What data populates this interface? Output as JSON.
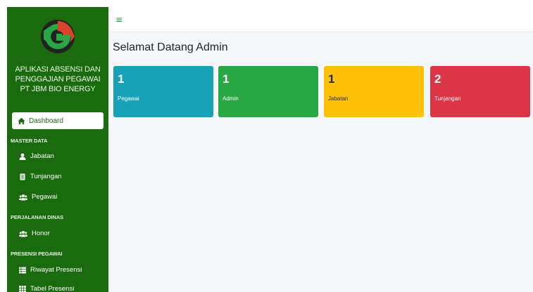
{
  "sidebar": {
    "brand_lines": [
      "APLIKASI ABSENSI DAN",
      "PENGGAJIAN PEGAWAI",
      "PT JBM BIO ENERGY"
    ],
    "active_item": {
      "label": "Dashboard",
      "icon": "home-icon"
    },
    "sections": [
      {
        "title": "MASTER DATA",
        "items": [
          {
            "label": "Jabatan",
            "icon": "user-icon"
          },
          {
            "label": "Tunjangan",
            "icon": "document-icon"
          },
          {
            "label": "Pegawai",
            "icon": "users-icon"
          }
        ]
      },
      {
        "title": "PERJALANAN DINAS",
        "items": [
          {
            "label": "Honor",
            "icon": "users-icon"
          }
        ]
      },
      {
        "title": "PRESENSI PEGAWAI",
        "items": [
          {
            "label": "Riwayat Presensi",
            "icon": "table-icon"
          },
          {
            "label": "Tabel Presensi",
            "icon": "grid-icon"
          }
        ]
      }
    ]
  },
  "topbar": {
    "menu_icon": "hamburger-icon",
    "menu_glyph": "≡"
  },
  "main": {
    "title": "Selamat Datang Admin",
    "cards": [
      {
        "value": "1",
        "label": "Pegawai",
        "color": "#17a2b8"
      },
      {
        "value": "1",
        "label": "Admin",
        "color": "#28a745"
      },
      {
        "value": "1",
        "label": "Jabatan",
        "color": "#ffc107"
      },
      {
        "value": "2",
        "label": "Tunjangan",
        "color": "#dc3545"
      }
    ]
  },
  "colors": {
    "sidebar": "#1a6b0e",
    "content_bg": "#f4f6f9"
  }
}
